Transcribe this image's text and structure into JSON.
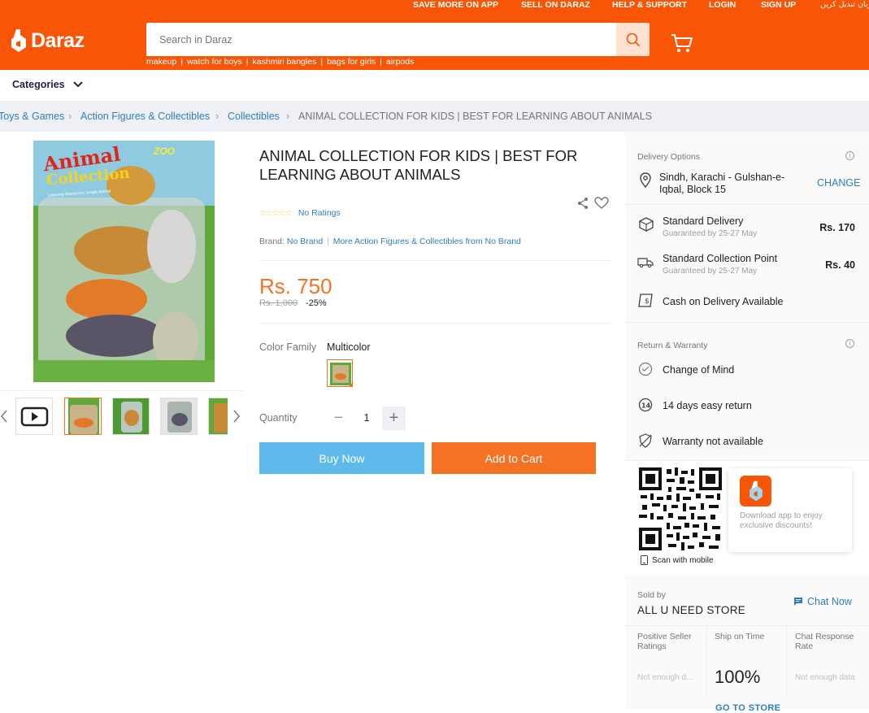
{
  "header": {
    "topnav": [
      "SAVE MORE ON APP",
      "SELL ON DARAZ",
      "HELP & SUPPORT",
      "LOGIN",
      "SIGN UP",
      "زبان تبدیل کریں"
    ],
    "logo_text": "Daraz",
    "search_placeholder": "Search in Daraz",
    "suggestions": [
      "makeup",
      "watch for boys",
      "kashmiri bangles",
      "bags for girls",
      "airpods"
    ],
    "brand_color": "#f85606"
  },
  "categories_label": "Categories",
  "breadcrumb": {
    "items": [
      "Toys & Games",
      "Action Figures & Collectibles",
      "Collectibles"
    ],
    "current": "ANIMAL COLLECTION FOR KIDS | BEST FOR LEARNING ABOUT ANIMALS"
  },
  "gallery": {
    "package_title_1": "Animal",
    "package_title_2": "Collection",
    "package_sub": "Learning Resources Jungle Animal",
    "package_zoo": "ZOO"
  },
  "product": {
    "title": "ANIMAL COLLECTION FOR KIDS | BEST FOR LEARNING ABOUT ANIMALS",
    "ratings_text": "No Ratings",
    "brand_label": "Brand:",
    "brand_value": "No Brand",
    "more_from": "More Action Figures & Collectibles from No Brand",
    "price": "Rs. 750",
    "old_price": "Rs. 1,000",
    "discount": "-25%",
    "color_label": "Color Family",
    "color_value": "Multicolor",
    "quantity_label": "Quantity",
    "quantity": "1",
    "minus": "−",
    "plus": "+",
    "buy_now": "Buy Now",
    "add_to_cart": "Add to Cart"
  },
  "delivery": {
    "heading": "Delivery Options",
    "address_line1": "Sindh, Karachi - Gulshan-e-",
    "address_line2": "Iqbal, Block 15",
    "change": "CHANGE",
    "options": [
      {
        "name": "Standard Delivery",
        "sub": "Guaranteed by 25-27 May",
        "price": "Rs. 170"
      },
      {
        "name": "Standard Collection Point",
        "sub": "Guaranteed by 25-27 May",
        "price": "Rs. 40"
      }
    ],
    "cod": "Cash on Delivery Available"
  },
  "warranty": {
    "heading": "Return & Warranty",
    "items": [
      "Change of Mind",
      "14 days easy return",
      "Warranty not available"
    ]
  },
  "app_promo": {
    "text": "Download app to enjoy exclusive discounts!",
    "scan": "Scan with mobile"
  },
  "seller": {
    "sold_by": "Sold by",
    "name": "ALL U NEED STORE",
    "chat": "Chat Now",
    "stats": [
      {
        "title": "Positive Seller Ratings",
        "value": "Not enough d..."
      },
      {
        "title": "Ship on Time",
        "value": "100%"
      },
      {
        "title": "Chat Response Rate",
        "value": "Not enough data"
      }
    ],
    "go_to_store": "GO TO STORE"
  }
}
